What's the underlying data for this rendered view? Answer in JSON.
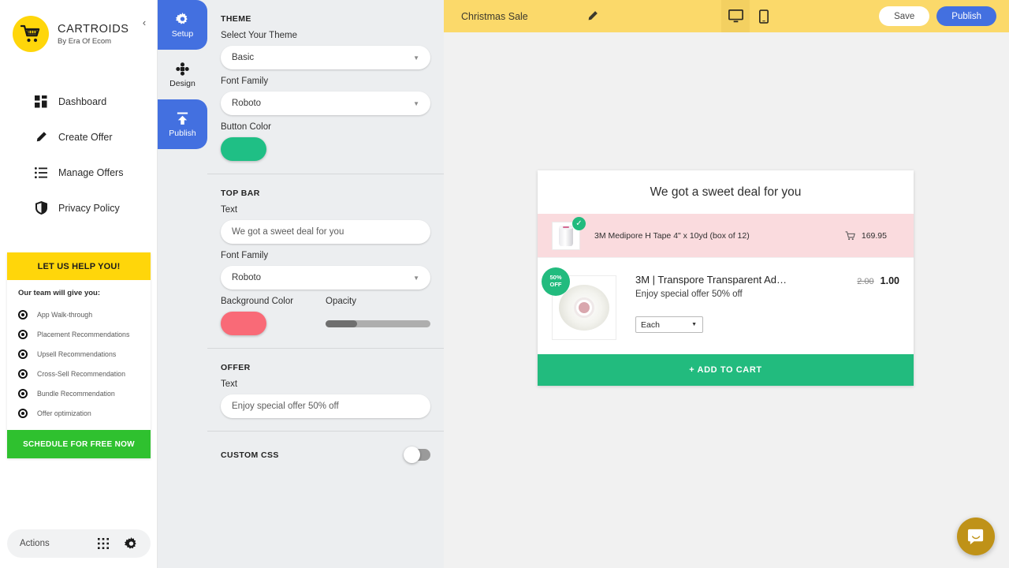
{
  "brand": {
    "logo_icon": "shopping-cart-icon",
    "title": "CARTROIDS",
    "subtitle": "By Era Of Ecom",
    "collapse_icon": "chevron-left-icon"
  },
  "sidebar": {
    "items": [
      {
        "label": "Dashboard",
        "icon": "dashboard-grid-icon"
      },
      {
        "label": "Create Offer",
        "icon": "pencil-icon"
      },
      {
        "label": "Manage Offers",
        "icon": "list-icon"
      },
      {
        "label": "Privacy Policy",
        "icon": "shield-icon"
      }
    ],
    "promo": {
      "heading": "LET US HELP YOU!",
      "intro": "Our team will give you:",
      "items": [
        "App Walk-through",
        "Placement Recommendations",
        "Upsell Recommendations",
        "Cross-Sell Recommendation",
        "Bundle Recommendation",
        "Offer optimization"
      ],
      "cta": "SCHEDULE FOR FREE NOW",
      "head_color": "#ffd60a",
      "cta_color": "#2fc12f"
    },
    "actions": {
      "label": "Actions",
      "apps_icon": "apps-grid-icon",
      "settings_icon": "gear-icon"
    }
  },
  "rail": {
    "tabs": [
      {
        "label": "Setup",
        "icon": "gear-icon",
        "active": false
      },
      {
        "label": "Design",
        "icon": "move-cross-icon",
        "active": true
      },
      {
        "label": "Publish",
        "icon": "upload-icon",
        "active": false
      }
    ],
    "active_color": "#4370e0"
  },
  "panel": {
    "theme": {
      "section": "THEME",
      "select_label": "Select Your Theme",
      "select_value": "Basic",
      "font_label": "Font Family",
      "font_value": "Roboto",
      "button_color_label": "Button Color",
      "button_color": "#1fbf85"
    },
    "topbar": {
      "section": "TOP BAR",
      "text_label": "Text",
      "text_value": "We got a sweet deal for you",
      "font_label": "Font Family",
      "font_value": "Roboto",
      "bg_label": "Background Color",
      "bg_color": "#f96a77",
      "opacity_label": "Opacity",
      "opacity_percent": 30
    },
    "offer": {
      "section": "OFFER",
      "text_label": "Text",
      "text_value": "Enjoy special offer 50% off"
    },
    "custom_css": {
      "section": "CUSTOM CSS",
      "enabled": false
    }
  },
  "header": {
    "title": "Christmas Sale",
    "edit_icon": "pencil-icon",
    "desktop_icon": "desktop-icon",
    "mobile_icon": "mobile-icon",
    "active_device": "desktop",
    "save_label": "Save",
    "publish_label": "Publish",
    "bg_color": "#fbd96a",
    "publish_color": "#4370e0"
  },
  "preview": {
    "heading": "We got a sweet deal for you",
    "cart_item": {
      "name": "3M Medipore H Tape 4\" x 10yd (box of 12)",
      "price": "169.95",
      "cart_icon": "shopping-cart-icon",
      "check_icon": "check-icon",
      "row_bg": "#fadbde"
    },
    "offer_item": {
      "badge_line1": "50%",
      "badge_line2": "OFF",
      "title": "3M | Transpore Transparent Ad…",
      "subtitle": "Enjoy special offer 50% off",
      "variant_value": "Each",
      "price_old": "2.00",
      "price_new": "1.00",
      "badge_color": "#22bb7e"
    },
    "cta_label": "+ ADD TO CART",
    "cta_color": "#22bb7e"
  },
  "chat": {
    "icon": "chat-bubble-icon",
    "color": "#bf9218"
  }
}
